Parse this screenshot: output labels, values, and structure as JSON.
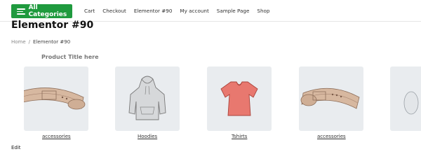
{
  "topbar": {
    "categories_button": "All Categories",
    "nav": [
      "Cart",
      "Checkout",
      "Elementor #90",
      "My account",
      "Sample Page",
      "Shop"
    ]
  },
  "page": {
    "title": "Elementor #90",
    "breadcrumb": {
      "home": "Home",
      "separator": "/",
      "current": "Elementor #90"
    },
    "product_title": "Product Title here",
    "edit_label": "Edit"
  },
  "categories": [
    {
      "label": "accessories",
      "icon": "belt-icon"
    },
    {
      "label": "Hoodies",
      "icon": "hoodie-icon"
    },
    {
      "label": "Tshirts",
      "icon": "tshirt-icon"
    },
    {
      "label": "accessories",
      "icon": "belt-icon"
    }
  ],
  "colors": {
    "accent": "#1f9a3e",
    "card_bg": "#e9ecef",
    "belt": "#c9a78d",
    "tshirt": "#e8786f"
  }
}
